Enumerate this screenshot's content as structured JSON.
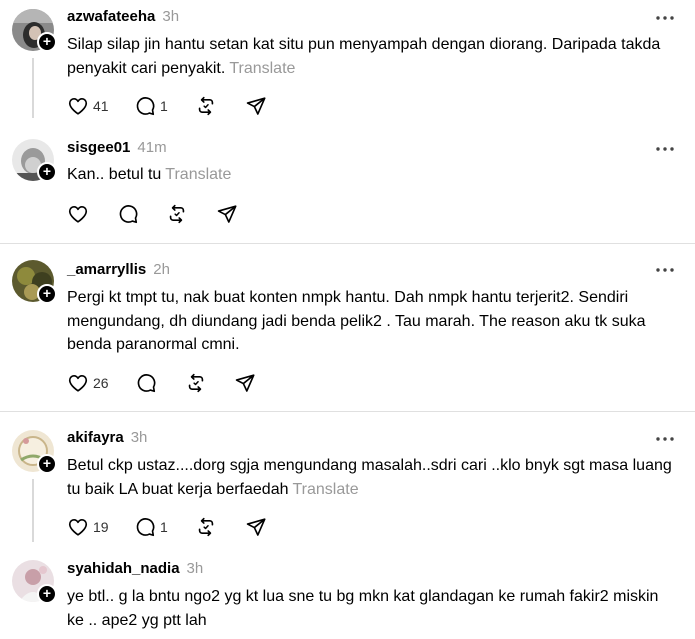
{
  "posts": [
    {
      "username": "azwafateeha",
      "time": "3h",
      "text": "Silap silap jin hantu setan kat situ pun menyampah dengan diorang. Daripada takda penyakit cari penyakit.",
      "translate": "Translate",
      "likes": "41",
      "replies": "1"
    },
    {
      "username": "sisgee01",
      "time": "41m",
      "text": "Kan.. betul tu",
      "translate": "Translate"
    },
    {
      "username": "_amarryllis",
      "time": "2h",
      "text": "Pergi kt tmpt tu, nak buat konten nmpk hantu. Dah nmpk hantu terjerit2. Sendiri mengundang, dh diundang jadi benda pelik2 . Tau marah. The reason aku tk suka benda paranormal cmni.",
      "likes": "26"
    },
    {
      "username": "akifayra",
      "time": "3h",
      "text": "Betul ckp ustaz....dorg sgja mengundang masalah..sdri cari ..klo bnyk sgt masa luang tu baik LA buat kerja berfaedah",
      "translate": "Translate",
      "likes": "19",
      "replies": "1"
    },
    {
      "username": "syahidah_nadia",
      "time": "3h",
      "text": "ye btl.. g la bntu ngo2 yg kt lua sne tu bg mkn kat glandagan ke rumah fakir2 miskin ke .. ape2 yg ptt lah"
    }
  ],
  "icons": {
    "like": "heart-icon",
    "reply": "comment-icon",
    "repost": "repost-icon",
    "share": "send-icon",
    "more": "more-horizontal-icon",
    "follow": "plus-icon"
  },
  "colors": {
    "text": "#000000",
    "muted": "#999999",
    "divider": "#e0e0e0",
    "thread_line": "#d9d9d9"
  }
}
